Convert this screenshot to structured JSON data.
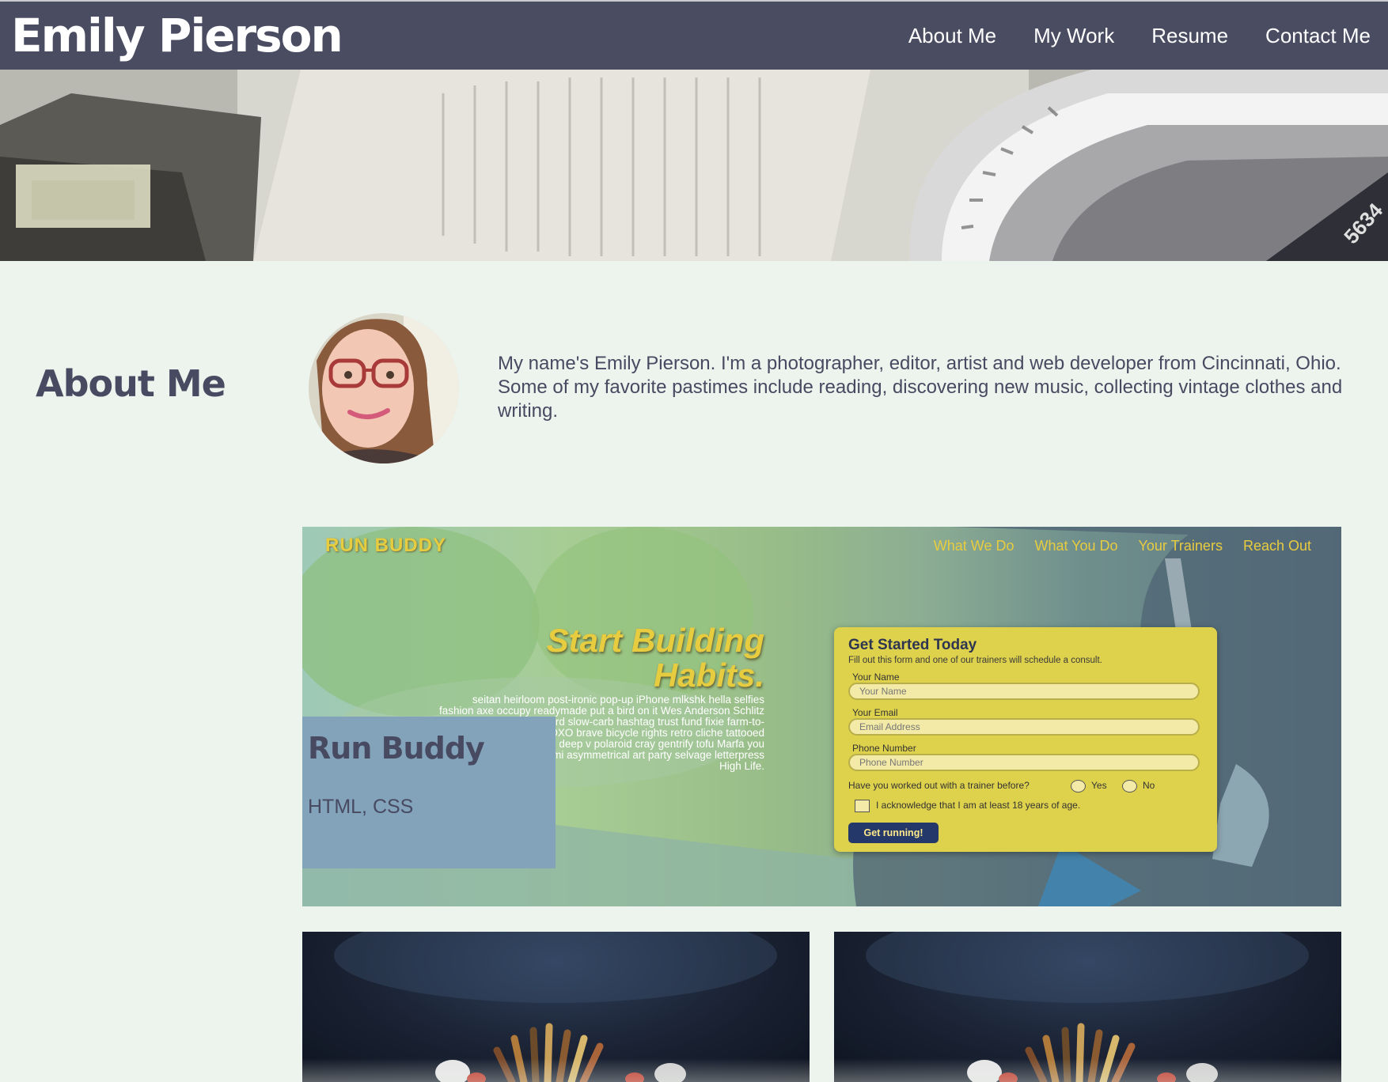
{
  "header": {
    "site_title": "Emily Pierson",
    "nav": [
      "About Me",
      "My Work",
      "Resume",
      "Contact Me"
    ]
  },
  "about": {
    "heading": "About Me",
    "text": "My name's Emily Pierson. I'm a photographer, editor, artist and web developer from Cincinnati, Ohio. Some of my favorite pastimes include reading, discovering new music, collecting vintage clothes and writing."
  },
  "hero": {
    "watch_number": "5634"
  },
  "featured_project": {
    "title": "Run Buddy",
    "tech": "HTML, CSS",
    "screenshot": {
      "logo": "RUN BUDDY",
      "nav": [
        "What We Do",
        "What You Do",
        "Your Trainers",
        "Reach Out"
      ],
      "headline_1": "Start Building",
      "headline_2": "Habits.",
      "body": "seitan heirloom post-ironic pop-up iPhone mlkshk hella selfies fashion axe occupy readymade put a bird on it Wes Anderson Schlitz plaid Bushwick skateboard slow-carb hashtag trust fund fixie farm-to-table 8-bit banjo XOXO brave bicycle rights retro cliche tattooed mumblecore Shoreditch deep v polaroid cray gentrify tofu Marfa you probably em yr banh mi asymmetrical art party selvage letterpress High Life.",
      "form": {
        "title": "Get Started Today",
        "subtitle": "Fill out this form and one of our trainers will schedule a consult.",
        "name_label": "Your Name",
        "name_placeholder": "Your Name",
        "email_label": "Your Email",
        "email_placeholder": "Email Address",
        "phone_label": "Phone Number",
        "phone_placeholder": "Phone Number",
        "question": "Have you worked out with a trainer before?",
        "yes": "Yes",
        "no": "No",
        "acknowledge": "I acknowledge that I am at least 18 years of age.",
        "button": "Get running!"
      }
    }
  },
  "colors": {
    "header_bg": "#4a4c62",
    "page_bg": "#edf3ed",
    "text": "#474a61",
    "project_label_bg": "#83a3bb",
    "runbuddy_yellow": "#e8cc3f"
  }
}
